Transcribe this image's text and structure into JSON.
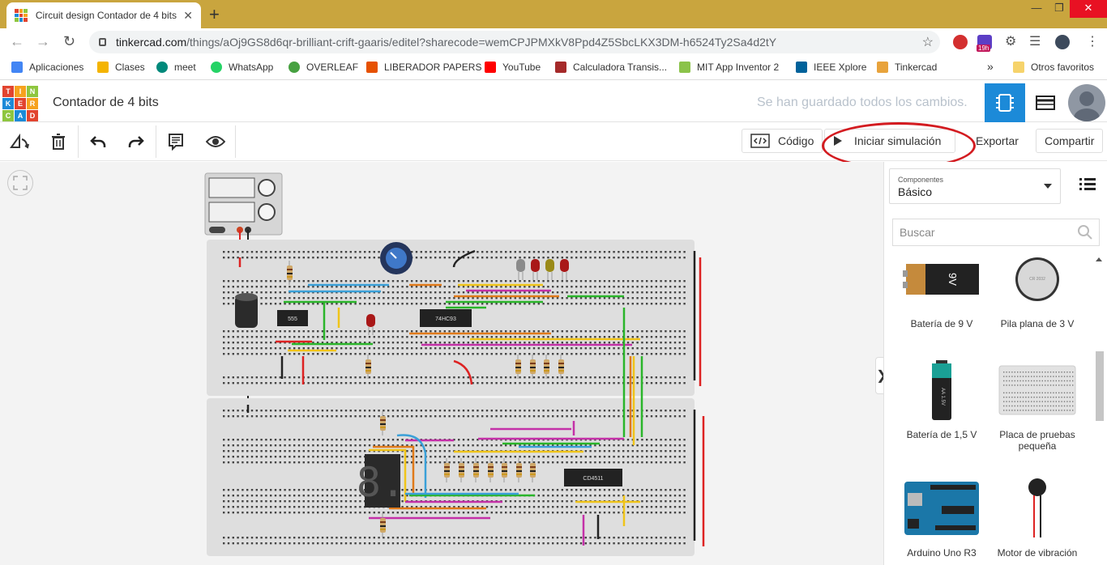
{
  "browser": {
    "tab_title": "Circuit design Contador de 4 bits",
    "tab_close": "✕",
    "new_tab": "+",
    "url_host": "tinkercad.com",
    "url_path": "/things/aOj9GS8d6qr-brilliant-crift-gaaris/editel?sharecode=wemCPJPMXkV8Ppd4Z5SbcLKX3DM-h6524Ty2Sa4d2tY",
    "ext_badge": "19h",
    "window_controls": {
      "min": "—",
      "max": "❐",
      "close": "✕"
    }
  },
  "bookmarks": {
    "items": [
      {
        "label": "Aplicaciones",
        "color": "#4285f4"
      },
      {
        "label": "Clases",
        "color": "#f4b400"
      },
      {
        "label": "meet",
        "color": "#00897b"
      },
      {
        "label": "WhatsApp",
        "color": "#25d366"
      },
      {
        "label": "OVERLEAF",
        "color": "#47a141"
      },
      {
        "label": "LIBERADOR PAPERS",
        "color": "#e65100"
      },
      {
        "label": "YouTube",
        "color": "#ff0000"
      },
      {
        "label": "Calculadora Transis...",
        "color": "#a52a2a"
      },
      {
        "label": "MIT App Inventor 2",
        "color": "#8bc34a"
      },
      {
        "label": "IEEE Xplore",
        "color": "#00629b"
      },
      {
        "label": "Tinkercad",
        "color": "#e8a33c"
      }
    ],
    "more": "»",
    "other": "Otros favoritos"
  },
  "tinkercad": {
    "logo_letters": [
      "T",
      "I",
      "N",
      "K",
      "E",
      "R",
      "C",
      "A",
      "D"
    ],
    "project_title": "Contador de 4 bits",
    "save_status": "Se han guardado todos los cambios.",
    "toolbar": {
      "code_label": "Código",
      "simulate_label": "Iniciar simulación",
      "export_label": "Exportar",
      "share_label": "Compartir"
    },
    "panel": {
      "components_label": "Componentes",
      "components_value": "Básico",
      "search_placeholder": "Buscar",
      "items": [
        {
          "label": "Batería de 9 V",
          "icon": "battery-9v-icon"
        },
        {
          "label": "Pila plana de 3 V",
          "icon": "coin-cell-icon"
        },
        {
          "label": "Batería de 1,5 V",
          "icon": "battery-aa-icon"
        },
        {
          "label": "Placa de pruebas pequeña",
          "icon": "breadboard-small-icon"
        },
        {
          "label": "Arduino Uno R3",
          "icon": "arduino-icon"
        },
        {
          "label": "Motor de vibración",
          "icon": "vibration-motor-icon"
        }
      ],
      "collapse_glyph": "❯"
    },
    "circuit": {
      "chips": [
        "555",
        "74HC93",
        "CD4511"
      ],
      "thumb_text": {
        "battery_9v": "9V",
        "battery_aa": "AA 1.5V"
      },
      "display_digit": "8."
    }
  },
  "colors": {
    "accent": "#1c8ad8",
    "annotation": "#d31b20",
    "tab_strip": "#c9a53e"
  }
}
